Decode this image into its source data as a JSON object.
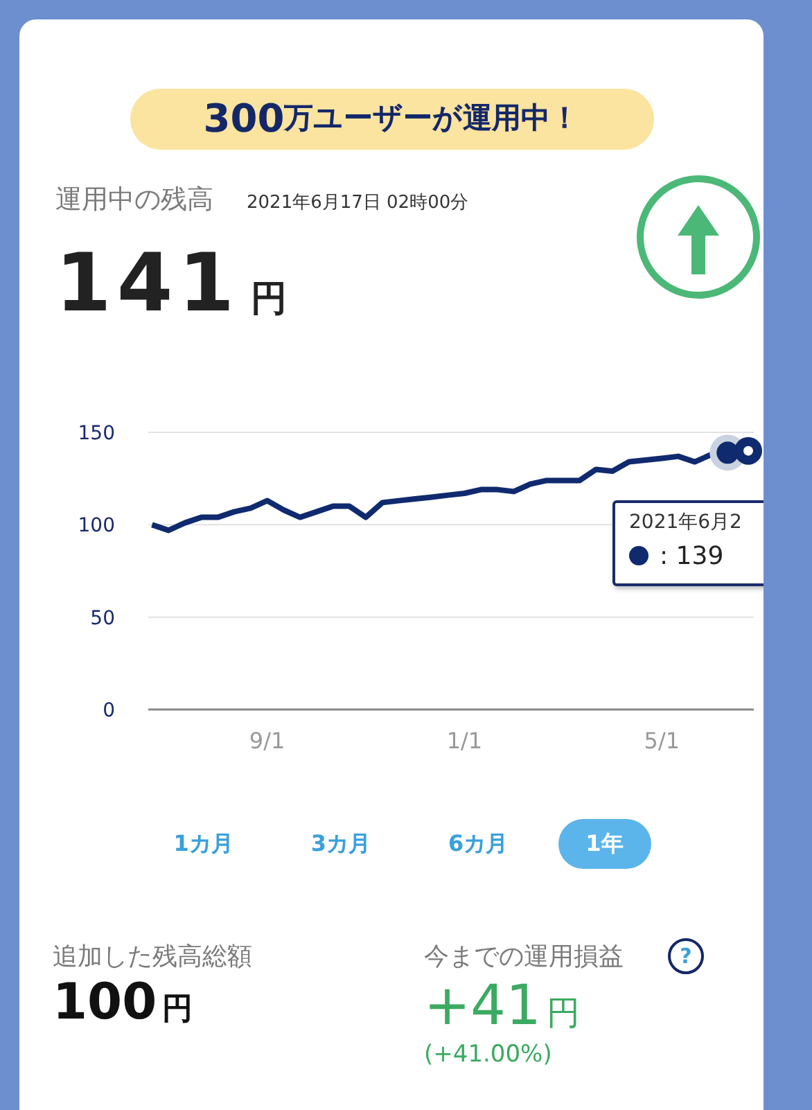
{
  "banner": {
    "number": "300",
    "text": "万ユーザーが運用中！"
  },
  "balance": {
    "label": "運用中の残高",
    "timestamp": "2021年6月17日 02時00分",
    "amount": "141",
    "unit": "円",
    "rising": true
  },
  "chart": {
    "chart_data": {
      "type": "line",
      "ylim": [
        0,
        150
      ],
      "yticks": [
        0,
        50,
        100,
        150
      ],
      "categories": [
        null,
        null,
        null,
        null,
        null,
        null,
        null,
        "9/1",
        null,
        null,
        null,
        null,
        null,
        null,
        null,
        null,
        null,
        null,
        null,
        "1/1",
        null,
        null,
        null,
        null,
        null,
        null,
        null,
        null,
        null,
        null,
        null,
        "5/1",
        null,
        null,
        null,
        null,
        null
      ],
      "series": [
        {
          "color": "#0f2a6e",
          "values": [
            100,
            97,
            101,
            104,
            104,
            107,
            109,
            113,
            108,
            104,
            107,
            110,
            110,
            104,
            112,
            113,
            114,
            115,
            116,
            117,
            119,
            119,
            118,
            122,
            124,
            124,
            124,
            130,
            129,
            134,
            135,
            136,
            137,
            134,
            138,
            139,
            140
          ]
        }
      ]
    },
    "tooltip": {
      "date": "2021年6月2",
      "value": ": 139"
    }
  },
  "periods": [
    {
      "label": "1カ月",
      "selected": false
    },
    {
      "label": "3カ月",
      "selected": false
    },
    {
      "label": "6カ月",
      "selected": false
    },
    {
      "label": "1年",
      "selected": true
    }
  ],
  "summary": [
    {
      "kind": "plain",
      "label": "追加した残高総額",
      "amount": "100",
      "unit": "円"
    },
    {
      "kind": "gain",
      "label": "今までの運用損益",
      "amount": "+41",
      "unit": "円",
      "percent": "(+41.00%)",
      "help": "?"
    }
  ]
}
